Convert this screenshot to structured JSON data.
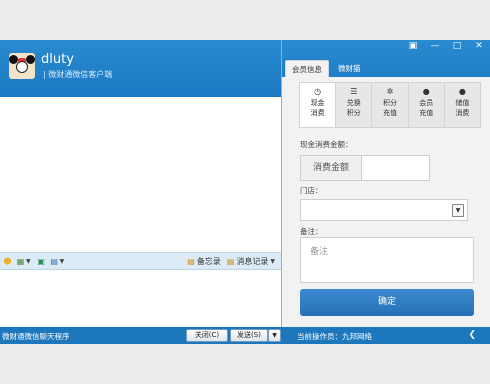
{
  "window": {
    "controls": [
      "▣",
      "—",
      "□",
      "✕"
    ]
  },
  "profile": {
    "name": "dluty",
    "subtitle": "| 微财通微信客户端"
  },
  "toolbar": {
    "memo_label": "备忘录",
    "history_label": "消息记录"
  },
  "status": {
    "left_text": "微财通微信聊天程序",
    "close_label": "关闭(C)",
    "send_label": "发送(S)",
    "operator": "当前操作员：九邦网络"
  },
  "panel": {
    "tabs": [
      "会员信息",
      "微财猫"
    ],
    "active_tab": 0,
    "inner_tabs": [
      {
        "line1": "现金",
        "line2": "消费",
        "icon": "clock-icon"
      },
      {
        "line1": "兑换",
        "line2": "积分",
        "icon": "list-icon"
      },
      {
        "line1": "积分",
        "line2": "充值",
        "icon": "gear-icon"
      },
      {
        "line1": "会员",
        "line2": "充值",
        "icon": "user-icon"
      },
      {
        "line1": "储值",
        "line2": "消费",
        "icon": "user-icon"
      }
    ],
    "form": {
      "amount_label": "现金消费金额：",
      "amount_addon": "消费金额",
      "store_label": "门店：",
      "note_label": "备注：",
      "note_placeholder": "备注",
      "confirm_label": "确定"
    }
  },
  "colors": {
    "titlebar": "#1a78c2",
    "statusbar": "#1c77bd",
    "confirm_button": "#2e7cc4"
  }
}
